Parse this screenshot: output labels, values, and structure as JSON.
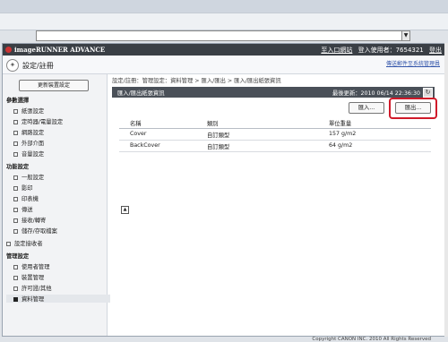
{
  "browser": {
    "address_value": "",
    "address_dropdown": "▼"
  },
  "app": {
    "title": "imageRUNNER ADVANCE",
    "remote_ui": "至入口網站",
    "user_label": "登入使用者：7654321",
    "logout": "登出"
  },
  "header": {
    "title": "設定/註冊",
    "guide_link": "傳送郵件至系統管理員"
  },
  "sidebar": {
    "update_button": "更新裝置設定",
    "categories": [
      {
        "label": "參數選擇",
        "items": [
          "紙張設定",
          "定時器/電量設定",
          "網路設定",
          "外部介面",
          "音量設定"
        ]
      },
      {
        "label": "功能設定",
        "items": [
          "一般設定",
          "影印",
          "印表機",
          "傳送",
          "接收/轉寄",
          "儲存/存取檔案"
        ]
      },
      {
        "label": "設定接收者",
        "items": []
      },
      {
        "label": "管理設定",
        "items": [
          "使用者管理",
          "裝置管理",
          "許可證/其他",
          "資料管理"
        ]
      }
    ]
  },
  "main": {
    "breadcrumb": "設定/註冊：管理設定：資料管理 > 匯入/匯出 > 匯入/匯出紙張資訊",
    "panel_title": "匯入/匯出紙張資訊",
    "last_updated": "最後更新：2010 06/14 22:36:30",
    "import_button": "匯入...",
    "export_button": "匯出...",
    "table": {
      "headers": [
        "名稱",
        "類別",
        "單位重量"
      ],
      "rows": [
        [
          "Cover",
          "自訂類型",
          "157 g/m2"
        ],
        [
          "BackCover",
          "自訂類型",
          "64 g/m2"
        ]
      ]
    },
    "footer": "Copyright CANON INC. 2010 All Rights Reserved"
  },
  "colors": {
    "appbar": "#3a3f45",
    "panelbar": "#4a5058",
    "highlight": "#d01a2a"
  }
}
